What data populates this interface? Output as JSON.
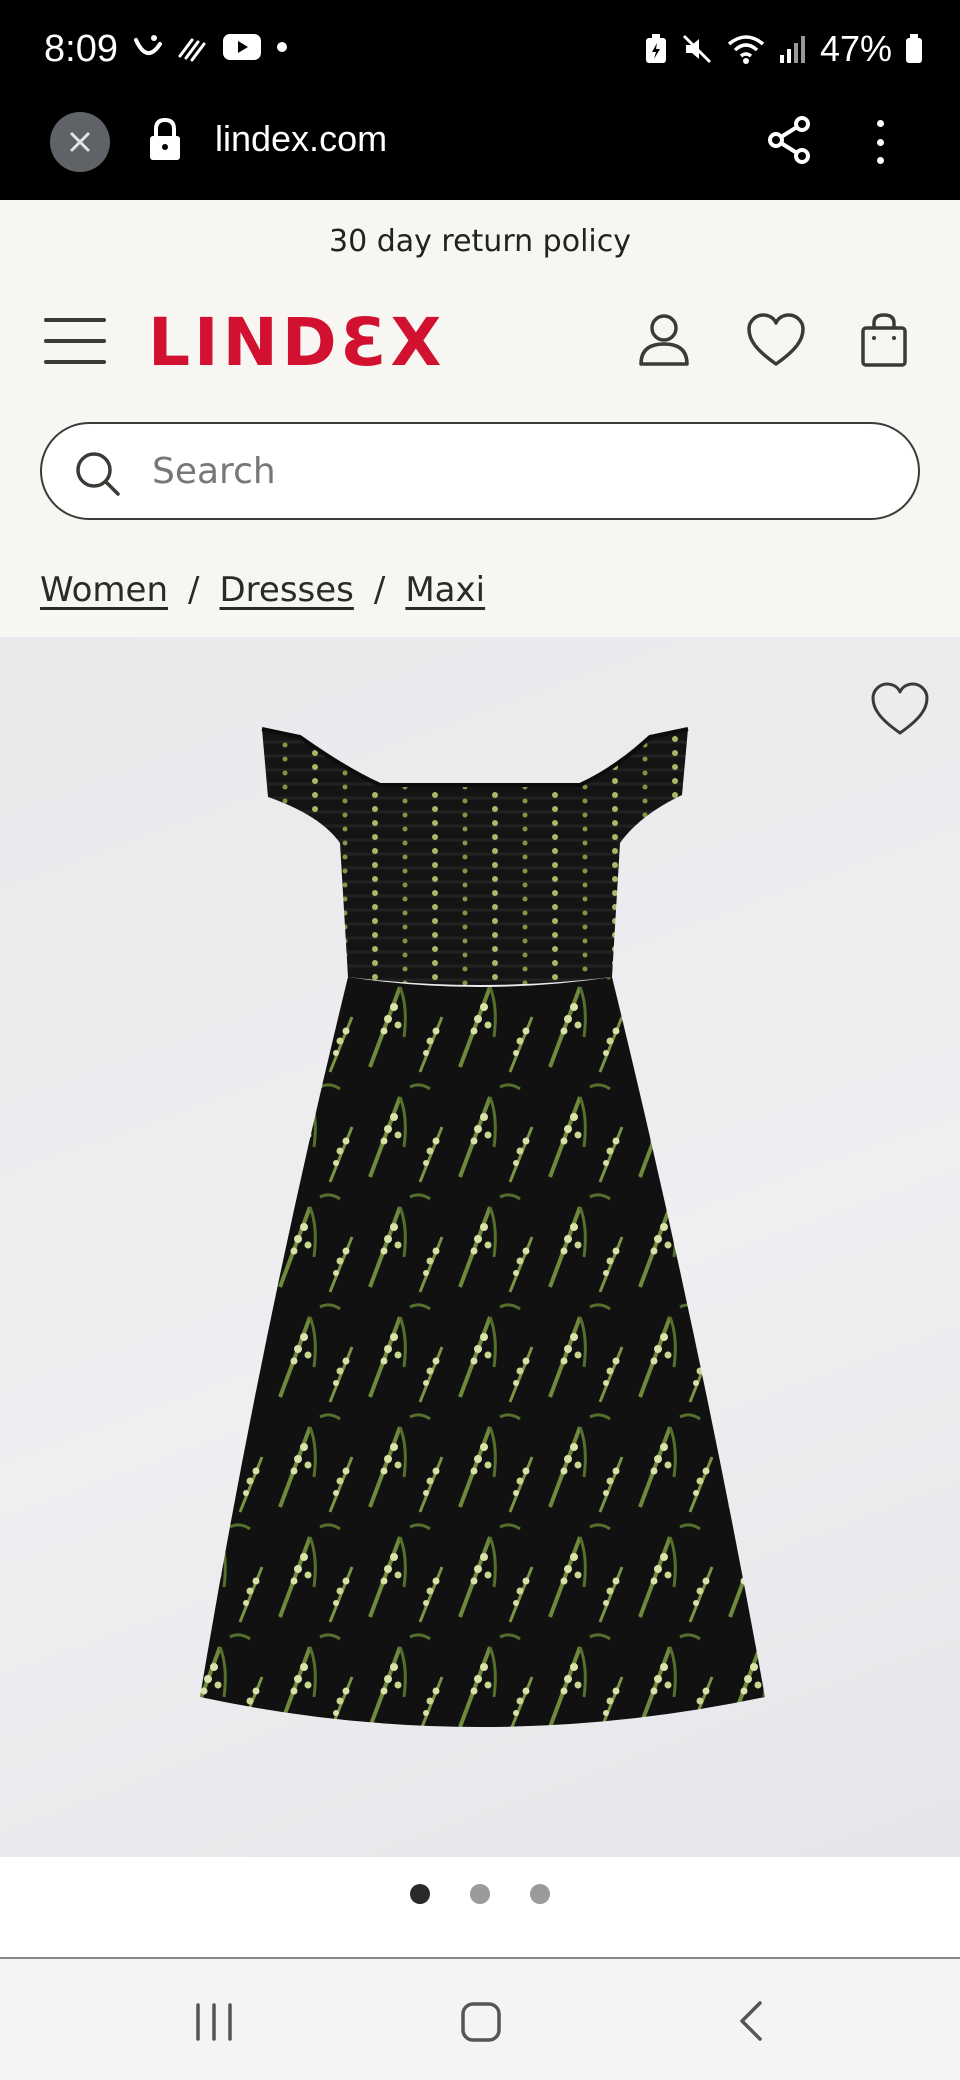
{
  "status_bar": {
    "time": "8:09",
    "battery": "47%",
    "icons": [
      "moon-icon",
      "signal-slash-icon",
      "youtube-icon",
      "dot-icon",
      "battery-saver-icon",
      "mute-icon",
      "wifi-icon",
      "cellular-icon",
      "battery-icon"
    ]
  },
  "browser": {
    "url": "lindex.com",
    "icons": [
      "close-icon",
      "lock-icon",
      "share-icon",
      "more-icon"
    ]
  },
  "header": {
    "promo": "30 day return policy",
    "logo": "LINDƐX",
    "brand_color": "#d1112f",
    "icons": [
      "menu-icon",
      "account-icon",
      "wishlist-icon",
      "bag-icon"
    ]
  },
  "search": {
    "placeholder": "Search",
    "value": ""
  },
  "breadcrumb": {
    "items": [
      "Women",
      "Dresses",
      "Maxi"
    ],
    "separator": "/"
  },
  "product": {
    "image_icon": "product-photo-dress",
    "wishlist_icon": "heart-icon"
  },
  "carousel": {
    "pages": 3,
    "active_page": 1
  },
  "nav": {
    "icons": [
      "recent-apps-icon",
      "home-icon",
      "back-icon"
    ]
  }
}
